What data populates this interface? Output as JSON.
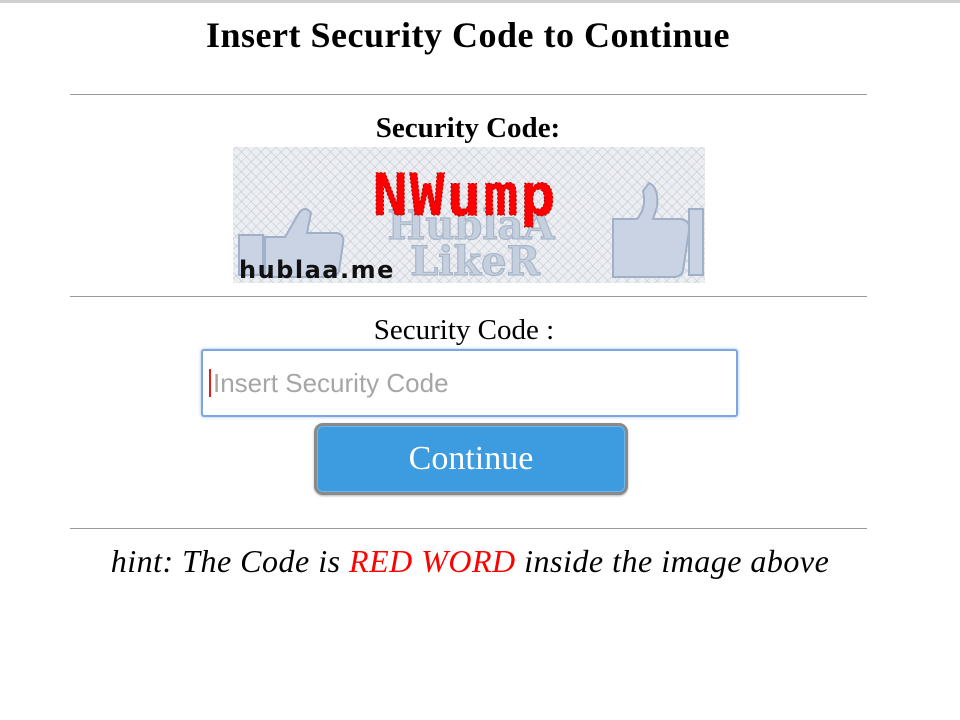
{
  "page": {
    "title": "Insert Security Code to Continue"
  },
  "captcha": {
    "heading": "Security Code:",
    "code_word": "NWump",
    "code_color": "#ff0000",
    "watermark_line1": "HublaA",
    "watermark_line2": "LikeR",
    "watermark_icon": "thumbs-up-icon",
    "site_label": "hublaa.me"
  },
  "form": {
    "label": "Security Code :",
    "input_placeholder": "Insert Security Code",
    "input_value": "",
    "button_label": "Continue",
    "button_color": "#3d9be0"
  },
  "hint": {
    "prefix": "hint: The Code is",
    "highlight": "RED WORD",
    "highlight_color": "#ff0000",
    "suffix": "inside the image above"
  }
}
